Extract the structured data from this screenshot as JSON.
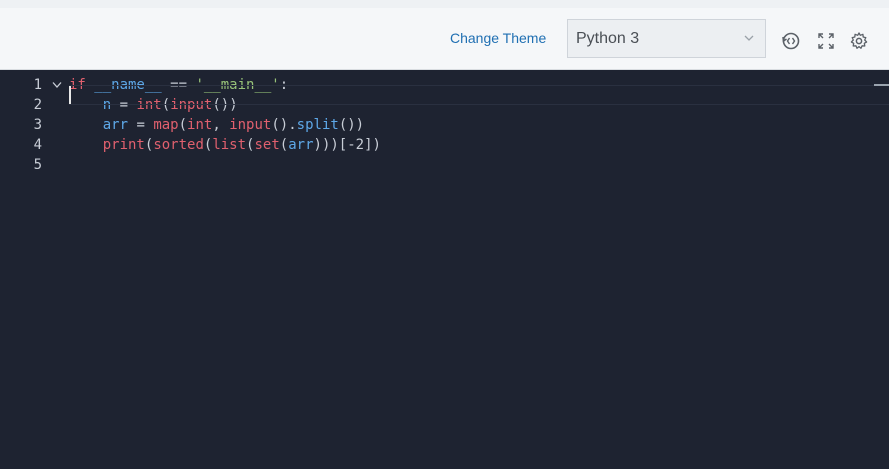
{
  "toolbar": {
    "change_theme_label": "Change Theme",
    "language_selected": "Python 3",
    "icons": [
      "history-icon",
      "fullscreen-icon",
      "settings-icon"
    ]
  },
  "editor": {
    "lines": [
      {
        "number": "1"
      },
      {
        "number": "2"
      },
      {
        "number": "3"
      },
      {
        "number": "4"
      },
      {
        "number": "5"
      }
    ],
    "code": {
      "l1": [
        "if",
        " __name__ ",
        "==",
        " ",
        "'__main__'",
        ":"
      ],
      "l2": [
        "    n ",
        "=",
        " ",
        "int",
        "(",
        "input",
        "())"
      ],
      "l3": [
        "    arr ",
        "=",
        " ",
        "map",
        "(",
        "int",
        ", ",
        "input",
        "().",
        "split",
        "())"
      ],
      "l4": [
        "    ",
        "print",
        "(",
        "sorted",
        "(",
        "list",
        "(",
        "set",
        "(",
        "arr",
        ")))[-2])"
      ]
    }
  },
  "colors": {
    "keyword": "#e0606e",
    "identifier": "#5ea8e8",
    "string": "#98c379",
    "background": "#1e2331",
    "link": "#1f6fb2"
  }
}
